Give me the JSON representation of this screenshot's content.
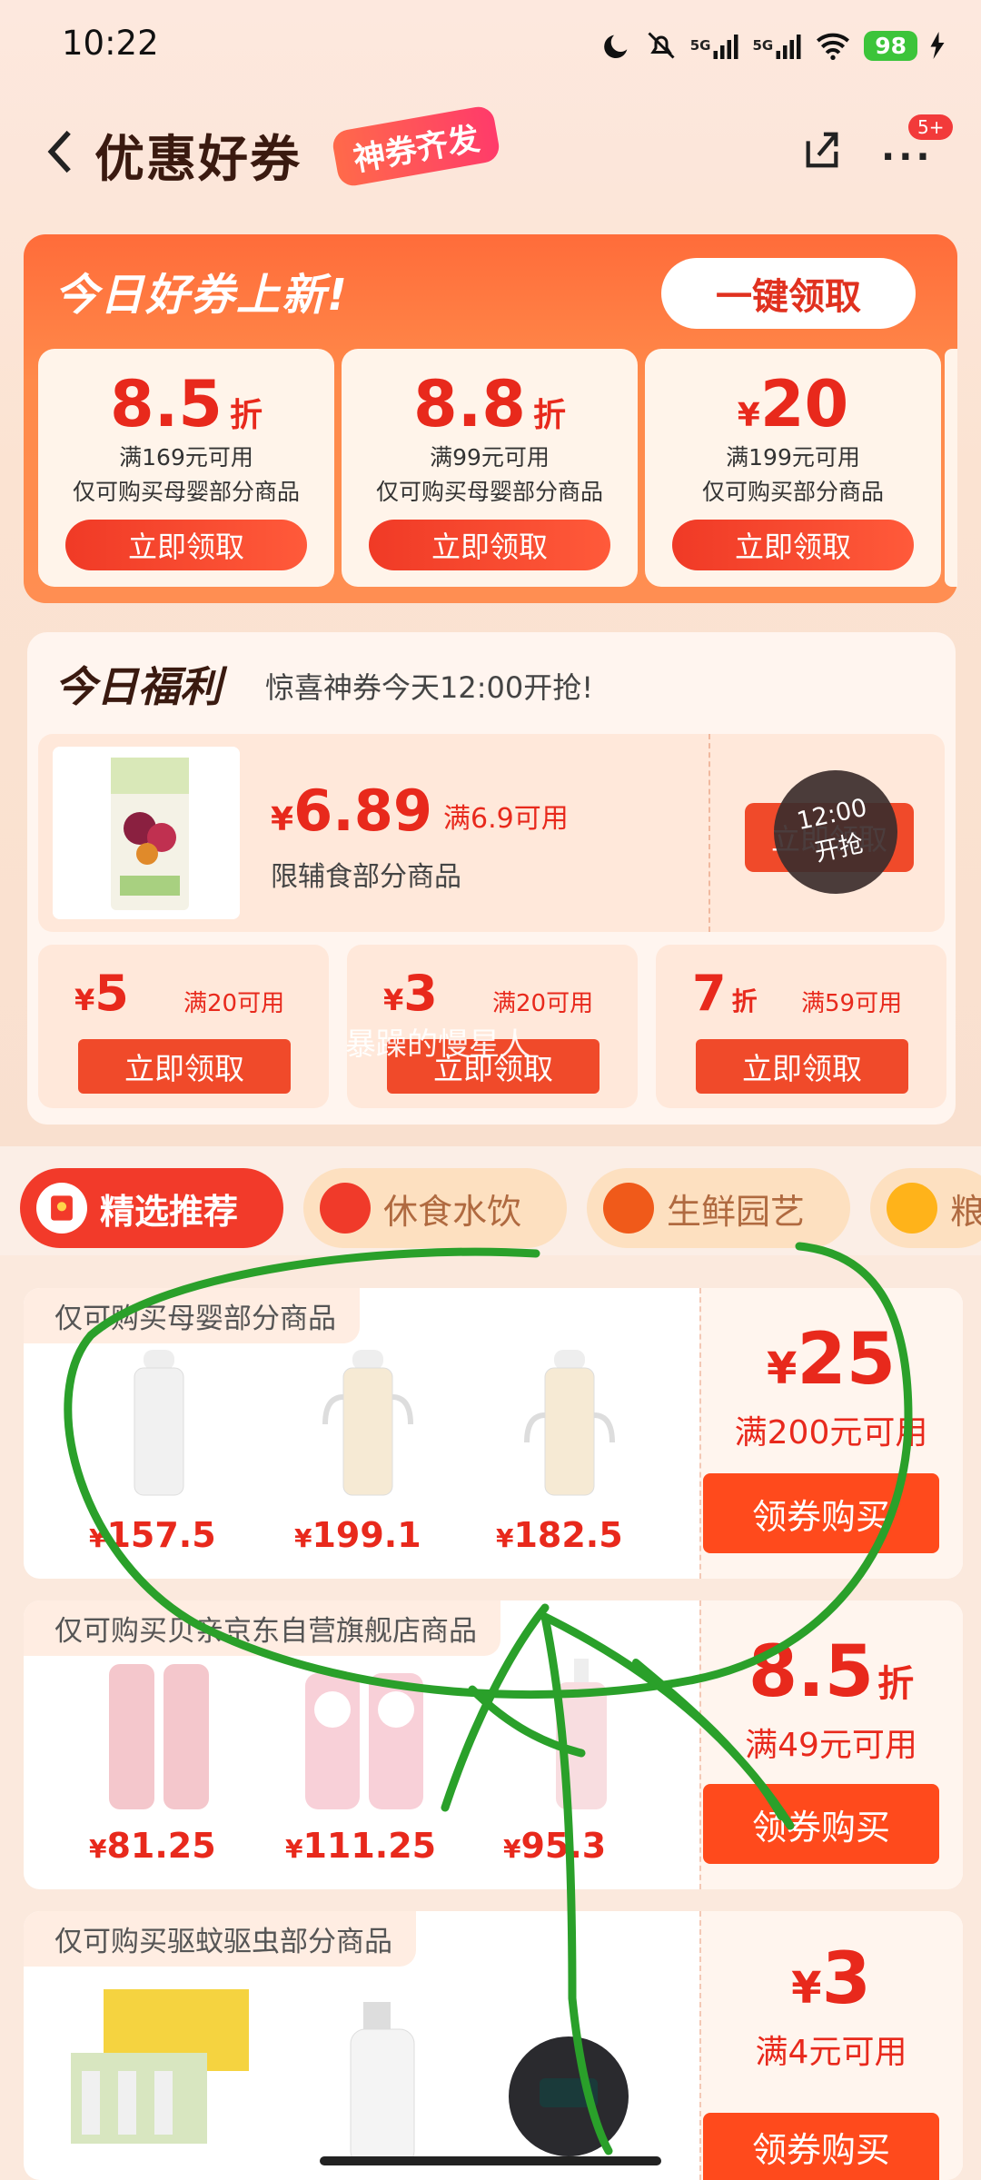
{
  "status": {
    "time": "10:22",
    "battery": "98",
    "sig1": "5G",
    "sig2": "5G"
  },
  "header": {
    "title": "优惠好券",
    "tag": "神券齐发",
    "notif": "5+",
    "more": "···"
  },
  "new_coupons": {
    "title": "今日好券上新!",
    "one_key": "一键领取",
    "items": [
      {
        "value": "8.5",
        "unit": "折",
        "cond": "满169元可用",
        "desc": "仅可购买母婴部分商品",
        "btn": "立即领取"
      },
      {
        "value": "8.8",
        "unit": "折",
        "cond": "满99元可用",
        "desc": "仅可购买母婴部分商品",
        "btn": "立即领取"
      },
      {
        "currency": "¥",
        "value": "20",
        "cond": "满199元可用",
        "desc": "仅可购买部分商品",
        "btn": "立即领取"
      }
    ]
  },
  "welfare": {
    "title": "今日福利",
    "subtitle": "惊喜神券今天12:00开抢!",
    "main": {
      "currency": "¥",
      "price": "6.89",
      "cond": "满6.9可用",
      "desc": "限辅食部分商品",
      "btn": "立即领取",
      "timer_time": "12:00",
      "timer_label": "开抢"
    },
    "small": [
      {
        "currency": "¥",
        "value": "5",
        "cond": "满20可用",
        "btn": "立即领取"
      },
      {
        "currency": "¥",
        "value": "3",
        "cond": "满20可用",
        "btn": "立即领取"
      },
      {
        "value": "7",
        "unit": "折",
        "cond": "满59可用",
        "btn": "立即领取"
      }
    ],
    "watermark": "暴躁的慢星人"
  },
  "tabs": [
    {
      "label": "精选推荐"
    },
    {
      "label": "休食水饮"
    },
    {
      "label": "生鲜园艺"
    },
    {
      "label": "粮"
    }
  ],
  "cards": [
    {
      "label": "仅可购买母婴部分商品",
      "prices": [
        "157.5",
        "199.1",
        "182.5"
      ],
      "currency": "¥",
      "value": "25",
      "cond": "满200元可用",
      "btn": "领券购买"
    },
    {
      "label": "仅可购买贝亲京东自营旗舰店商品",
      "prices": [
        "81.25",
        "111.25",
        "95.3"
      ],
      "currency": "¥",
      "value": "8.5",
      "unit": "折",
      "cond": "满49元可用",
      "btn": "领券购买"
    },
    {
      "label": "仅可购买驱蚊驱虫部分商品",
      "prices": [],
      "currency": "¥",
      "value": "3",
      "cond": "满4元可用",
      "btn": "领券购买"
    }
  ],
  "colors": {
    "accent": "#e8291c",
    "panel": "#ff7a42",
    "button": "#f04a2a"
  }
}
